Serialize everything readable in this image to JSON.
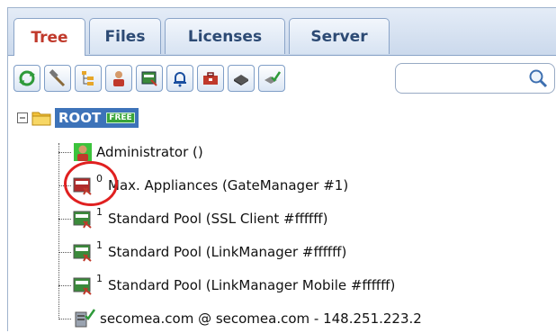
{
  "tabs": [
    {
      "label": "Tree",
      "active": true
    },
    {
      "label": "Files",
      "active": false
    },
    {
      "label": "Licenses",
      "active": false
    },
    {
      "label": "Server",
      "active": false
    }
  ],
  "toolbar": {
    "buttons": [
      "refresh-icon",
      "hammer-icon",
      "tree-view-icon",
      "user-icon",
      "appliance-icon",
      "bell-icon",
      "toolbox-icon",
      "disk-icon",
      "check-disk-icon"
    ]
  },
  "search": {
    "value": "",
    "placeholder": ""
  },
  "tree": {
    "root": {
      "label": "ROOT",
      "badge": "FREE"
    },
    "items": [
      {
        "label": "Administrator ()",
        "count": "",
        "icon": "user-icon"
      },
      {
        "label": "Max. Appliances (GateManager #1)",
        "count": "0",
        "icon": "license-red-icon"
      },
      {
        "label": "Standard Pool (SSL Client #ffffff)",
        "count": "1",
        "icon": "license-green-icon"
      },
      {
        "label": "Standard Pool (LinkManager #ffffff)",
        "count": "1",
        "icon": "license-green-icon"
      },
      {
        "label": "Standard Pool (LinkManager Mobile #ffffff)",
        "count": "1",
        "icon": "license-green-icon"
      },
      {
        "label": "secomea.com @ secomea.com - 148.251.223.2",
        "count": "",
        "icon": "server-check-icon"
      }
    ]
  },
  "colors": {
    "accent": "#c0392b",
    "selection": "#3d73b9",
    "highlight": "#e02020"
  }
}
